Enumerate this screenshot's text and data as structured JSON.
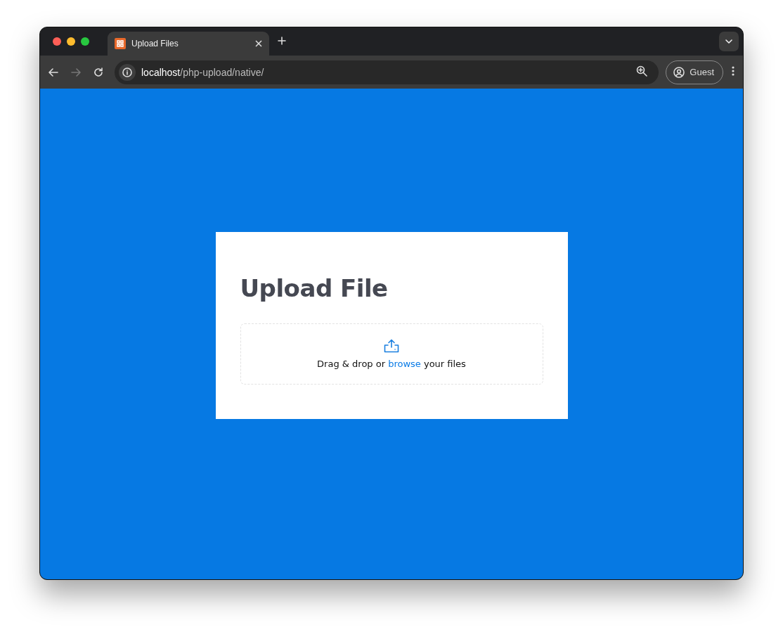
{
  "browser": {
    "tabs": [
      {
        "title": "Upload Files",
        "selected": true
      }
    ],
    "nav": {
      "back_disabled": false,
      "forward_disabled": true
    },
    "address": {
      "host": "localhost",
      "path": "/php-upload/native/"
    },
    "profile": {
      "label": "Guest"
    }
  },
  "card": {
    "title": "Upload File",
    "drop_zone": {
      "text_before": "Drag & drop or ",
      "link": "browse",
      "text_after": " your files"
    }
  }
}
